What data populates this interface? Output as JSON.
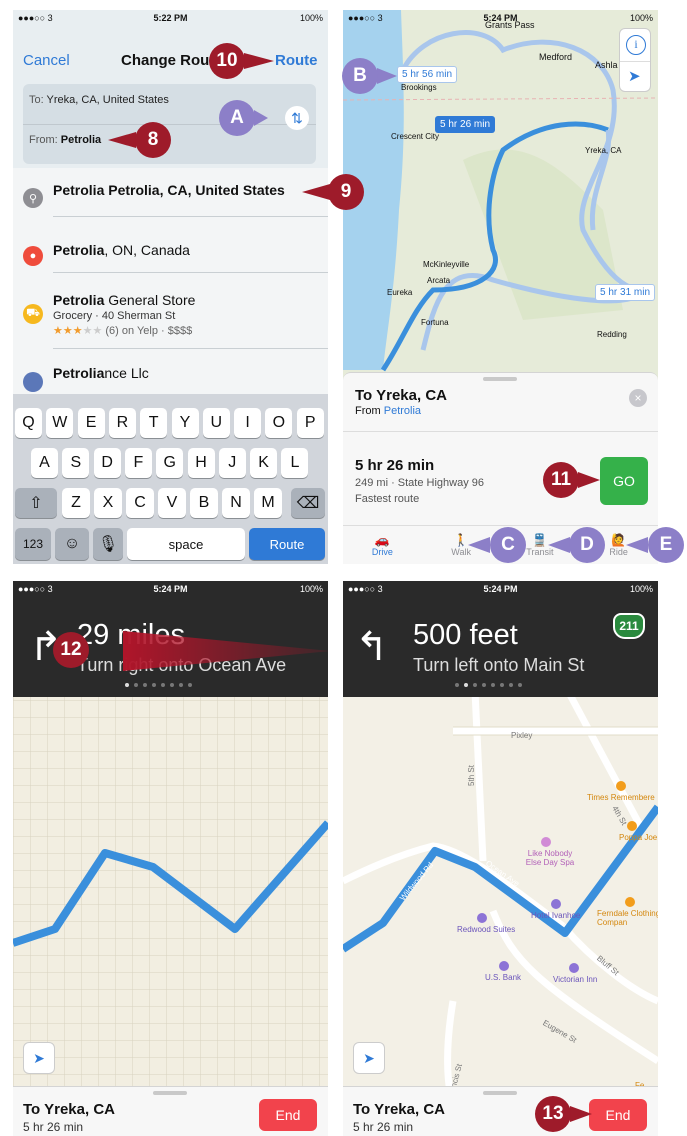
{
  "status": {
    "p1": {
      "carrier": "●●●○○ 3",
      "time": "5:22 PM",
      "battery": "100%"
    },
    "p2": {
      "carrier": "●●●○○ 3",
      "time": "5:24 PM",
      "battery": "100%"
    },
    "p3": {
      "carrier": "●●●○○ 3",
      "time": "5:24 PM",
      "battery": "100%"
    },
    "p4": {
      "carrier": "●●●○○ 3",
      "time": "5:24 PM",
      "battery": "100%"
    }
  },
  "change_route": {
    "cancel": "Cancel",
    "title": "Change Rou",
    "route": "Route",
    "to_label": "To:",
    "to_value": "Yreka, CA, United States",
    "from_label": "From:",
    "from_value": "Petrolia"
  },
  "suggestions": [
    {
      "title_bold": "Petrolia Petrolia, CA, United States",
      "title_rest": "",
      "icon": "search-icon"
    },
    {
      "title_bold": "Petrolia",
      "title_rest": ", ON, Canada",
      "icon": "pin-icon"
    },
    {
      "title_bold": "Petrolia",
      "title_rest": " General Store",
      "sub": "Grocery · 40 Sherman St",
      "rating": "★★★",
      "rating_dim": "★★",
      "reviews": "(6) on Yelp · $$$$",
      "icon": "cart-icon"
    },
    {
      "title_bold": "Petrolia",
      "title_rest": "nce Llc",
      "icon": "business-icon"
    }
  ],
  "keyboard": {
    "row1": [
      "Q",
      "W",
      "E",
      "R",
      "T",
      "Y",
      "U",
      "I",
      "O",
      "P"
    ],
    "row2": [
      "A",
      "S",
      "D",
      "F",
      "G",
      "H",
      "J",
      "K",
      "L"
    ],
    "row3": [
      "Z",
      "X",
      "C",
      "V",
      "B",
      "N",
      "M"
    ],
    "numbers": "123",
    "space": "space",
    "route": "Route"
  },
  "map_overview": {
    "bubbles": [
      "5 hr 56 min",
      "5 hr 26 min",
      "5 hr 31 min"
    ],
    "places": [
      "Grants Pass",
      "Medford",
      "Ashla",
      "Brookings",
      "Crescent City",
      "Yreka, CA",
      "McKinleyville",
      "Arcata",
      "Eureka",
      "Fortuna",
      "Redding"
    ],
    "dest_title": "To Yreka, CA",
    "from_prefix": "From ",
    "from_place": "Petrolia",
    "duration": "5 hr 26 min",
    "details": "249 mi · State Highway 96",
    "fastest": "Fastest route",
    "go": "GO",
    "tabs": [
      "Drive",
      "Walk",
      "Transit",
      "Ride"
    ]
  },
  "nav1": {
    "distance": "29 miles",
    "instruction": "Turn right onto Ocean Ave",
    "dest": "To Yreka, CA",
    "eta": "5 hr 26 min",
    "end": "End"
  },
  "nav2": {
    "distance": "500 feet",
    "instruction": "Turn left onto Main St",
    "shield": "211",
    "streets": [
      "Pixley",
      "5th St",
      "4th St",
      "Wildwood Rd",
      "Ocean Ave",
      "Bluff St",
      "Eugene St",
      "Francis St"
    ],
    "pois": [
      "Times Remembere",
      "Poppa Joe",
      "Like Nobody Else Day Spa",
      "Hotel Ivanhoe",
      "Redwood Suites",
      "Ferndale Clothing Compan",
      "U.S. Bank",
      "Victorian Inn",
      "Fe Music"
    ],
    "dest": "To Yreka, CA",
    "eta": "5 hr 26 min",
    "end": "End"
  },
  "callouts": [
    "A",
    "B",
    "C",
    "D",
    "E",
    "8",
    "9",
    "10",
    "11",
    "12",
    "13"
  ],
  "colors": {
    "ios_blue": "#2f7ad6",
    "route_blue": "#3a8fdc",
    "alt_route": "#a9c6ec",
    "go_green": "#35b14a",
    "end_red": "#f2434c",
    "callout_red": "#9e1b2a",
    "callout_purple": "#8c7fc8"
  }
}
